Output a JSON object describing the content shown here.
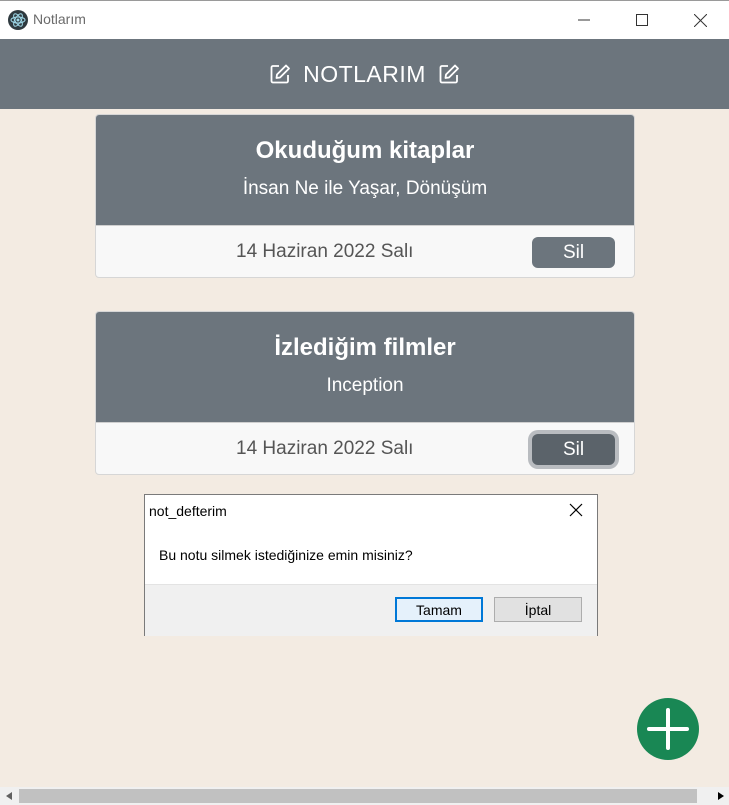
{
  "window": {
    "title": "Notlarım"
  },
  "header": {
    "title": "NOTLARIM"
  },
  "notes": [
    {
      "title": "Okuduğum kitaplar",
      "text": "İnsan Ne ile Yaşar, Dönüşüm",
      "date": "14 Haziran 2022 Salı",
      "delete_label": "Sil"
    },
    {
      "title": "İzlediğim filmler",
      "text": "Inception",
      "date": "14 Haziran 2022 Salı",
      "delete_label": "Sil"
    }
  ],
  "dialog": {
    "title": "not_defterim",
    "message": "Bu notu silmek istediğinize emin misiniz?",
    "ok_label": "Tamam",
    "cancel_label": "İptal"
  },
  "colors": {
    "background": "#f3ebe2",
    "header": "#6c757d",
    "fab": "#198754",
    "dialog_focus": "#0078d7"
  },
  "icons": {
    "app": "electron-app-icon",
    "header_left": "edit-icon",
    "header_right": "edit-icon",
    "fab": "plus-icon"
  }
}
